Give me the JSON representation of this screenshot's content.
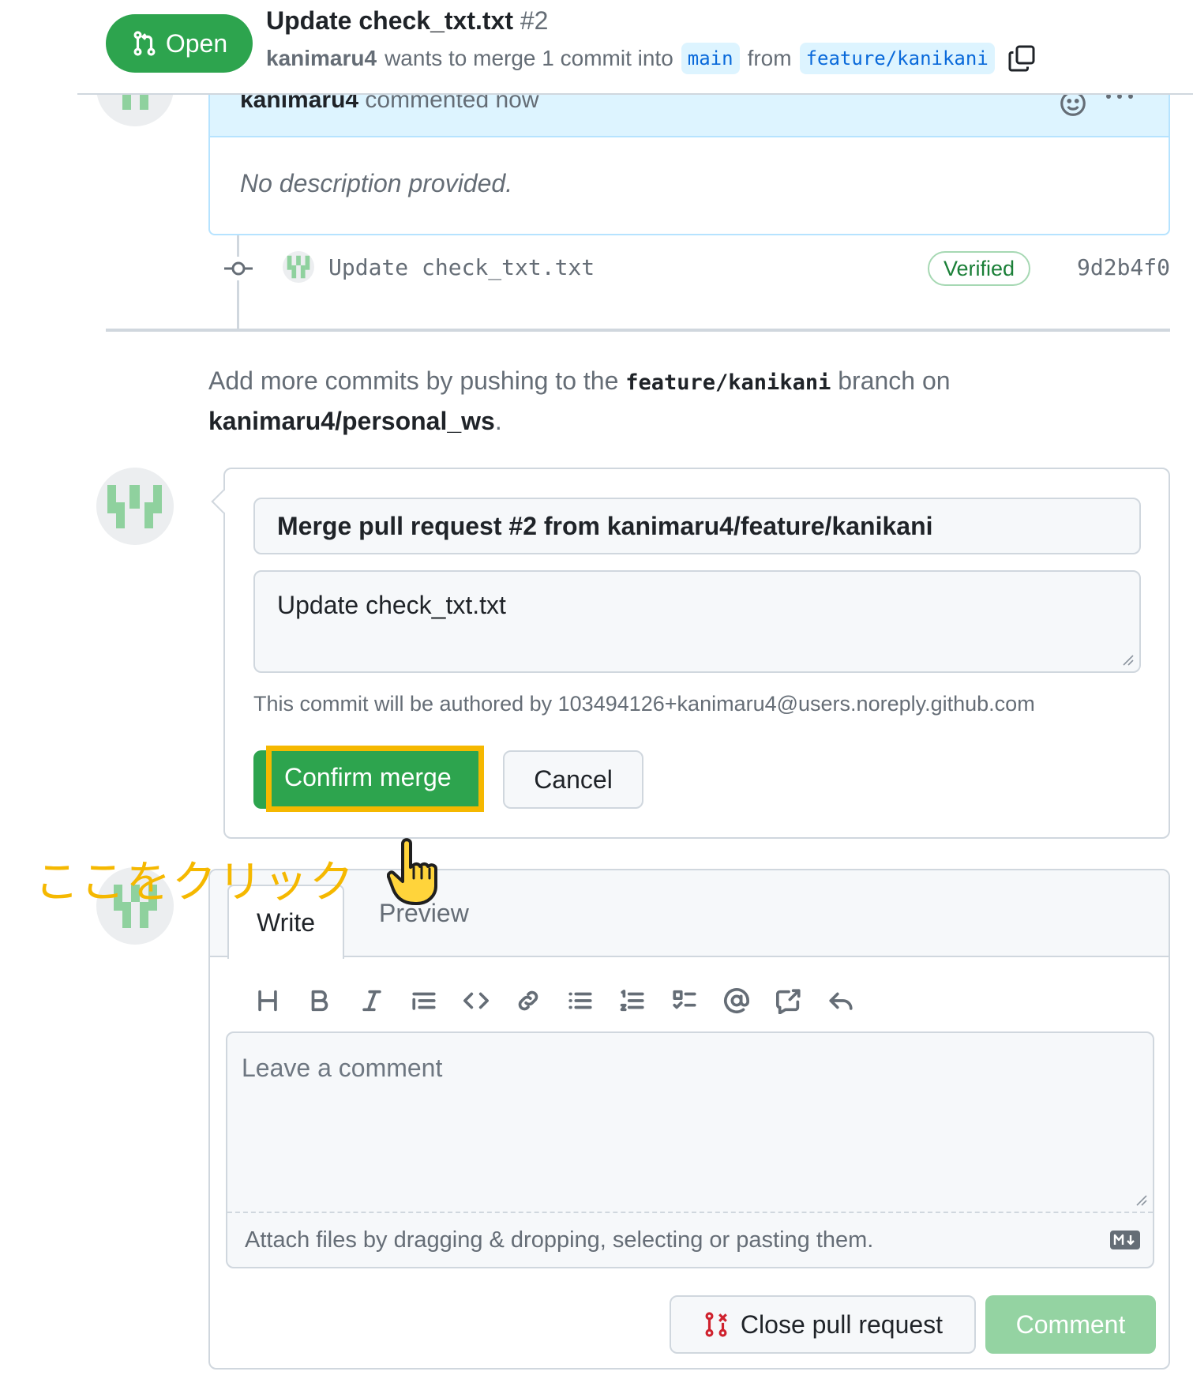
{
  "header": {
    "state": "Open",
    "title": "Update check_txt.txt",
    "number": "#2",
    "author": "kanimaru4",
    "merge_text": "wants to merge 1 commit into",
    "base_branch": "main",
    "from_text": "from",
    "head_branch": "feature/kanikani"
  },
  "description": {
    "author": "kanimaru4",
    "action": "commented now",
    "body": "No description provided."
  },
  "commit": {
    "message": "Update check_txt.txt",
    "badge": "Verified",
    "sha": "9d2b4f0"
  },
  "push_hint": {
    "prefix": "Add more commits by pushing to the",
    "branch": "feature/kanikani",
    "middle": "branch on",
    "repo": "kanimaru4/personal_ws",
    "suffix": "."
  },
  "merge_form": {
    "title_value": "Merge pull request #2 from kanimaru4/feature/kanikani",
    "body_value": "Update check_txt.txt",
    "author_note": "This commit will be authored by 103494126+kanimaru4@users.noreply.github.com",
    "confirm_label": "Confirm merge",
    "cancel_label": "Cancel"
  },
  "annotation": {
    "text": "ここをクリック",
    "color": "#f5b800"
  },
  "composer": {
    "tab_write": "Write",
    "tab_preview": "Preview",
    "toolbar_icons": [
      "heading-icon",
      "bold-icon",
      "italic-icon",
      "quote-icon",
      "code-icon",
      "link-icon",
      "bulleted-list-icon",
      "numbered-list-icon",
      "task-list-icon",
      "mention-icon",
      "cross-reference-icon",
      "reply-icon"
    ],
    "placeholder": "Leave a comment",
    "attach_text": "Attach files by dragging & dropping, selecting or pasting them.",
    "close_label": "Close pull request",
    "comment_label": "Comment"
  },
  "colors": {
    "open_green": "#2da44e",
    "link_blue": "#0969da",
    "highlight": "#f5b800",
    "comment_disabled": "#94d3a2"
  }
}
